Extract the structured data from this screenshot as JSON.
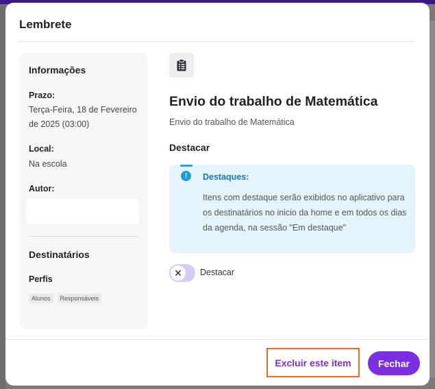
{
  "modal": {
    "title": "Lembrete"
  },
  "info": {
    "heading": "Informações",
    "deadline_label": "Prazo:",
    "deadline_value": "Terça-Feira, 18 de Fevereiro de 2025 (03:00)",
    "location_label": "Local:",
    "location_value": "Na escola",
    "author_label": "Autor:",
    "recipients_heading": "Destinatários",
    "profiles_label": "Perfis",
    "profiles": [
      "Alunos",
      "Responsáveis"
    ]
  },
  "main": {
    "icon": "clipboard-icon",
    "title": "Envio do trabalho de Matemática",
    "subtitle": "Envio do trabalho de Matemática",
    "highlight_heading": "Destacar"
  },
  "notice": {
    "icon": "exclamation-circle-icon",
    "title": "Destaques:",
    "text": "Itens com destaque serão exibidos no aplicativo para os destinatários no inicio da home e em todos os dias da agenda, na sessão \"Em destaque\""
  },
  "toggle": {
    "label": "Destacar",
    "icon": "x-icon",
    "state": "off"
  },
  "footer": {
    "delete_label": "Excluir este item",
    "close_label": "Fechar"
  },
  "colors": {
    "accent": "#7b2fe3",
    "delete_text": "#7a2fd8",
    "delete_border": "#f26a1d",
    "notice_bg": "#e3f4fb",
    "notice_title": "#1a76b0"
  }
}
